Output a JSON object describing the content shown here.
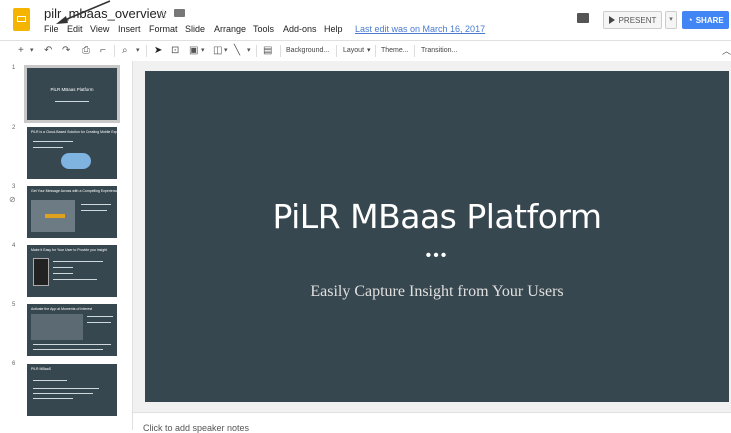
{
  "title_bar": {
    "doc_title": "pilr_mbaas_overview",
    "last_edit": "Last edit was on March 16, 2017",
    "menus": [
      "File",
      "Edit",
      "View",
      "Insert",
      "Format",
      "Slide",
      "Arrange",
      "Tools",
      "Add-ons",
      "Help"
    ],
    "present_label": "PRESENT",
    "share_label": "SHARE"
  },
  "toolbar": {
    "background": "Background...",
    "layout": "Layout",
    "theme": "Theme...",
    "transition": "Transition..."
  },
  "slides": [
    {
      "num": "1",
      "title": "PiLR MBaas Platform"
    },
    {
      "num": "2",
      "title": "PiLR is a Cloud-Based Solution for Creating Mobile Experiences"
    },
    {
      "num": "3",
      "title": "Get Your Message Across with a Compelling Experience"
    },
    {
      "num": "4",
      "title": "Make it Easy for Your User to Provide you Insight"
    },
    {
      "num": "5",
      "title": "Activate the App at Moments of Interest"
    },
    {
      "num": "6",
      "title": "PiLR MBaaS"
    }
  ],
  "main_slide": {
    "title": "PiLR MBaas Platform",
    "dots": "•••",
    "subtitle": "Easily Capture Insight from Your Users"
  },
  "notes": {
    "placeholder": "Click to add speaker notes"
  },
  "colors": {
    "slide_bg": "#37474f",
    "share_blue": "#4285f4",
    "logo_yellow": "#f4b400"
  }
}
